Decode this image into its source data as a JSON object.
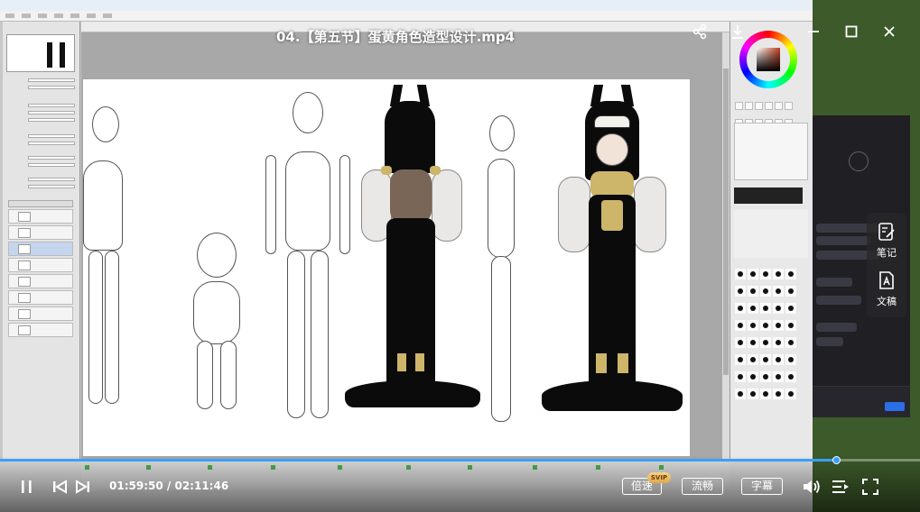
{
  "player": {
    "title": "04.【第五节】蛋黄角色造型设计.mp4",
    "current_time": "01:59:50",
    "separator": "/",
    "duration": "02:11:46",
    "progress": 0.909,
    "speed_label": "倍速",
    "svip_badge": "SVIP",
    "quality_label": "流畅",
    "subtitle_label": "字幕",
    "side_tools": [
      {
        "label": "笔记"
      },
      {
        "label": "文稿"
      }
    ],
    "accent_color": "#3aa0ff"
  }
}
